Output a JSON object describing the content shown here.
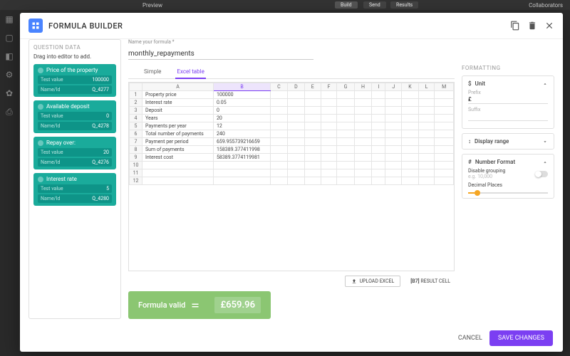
{
  "backdrop": {
    "preview": "Preview",
    "tabs": [
      "Build",
      "Send",
      "Results"
    ],
    "collaborators": "Collaborators"
  },
  "modal": {
    "title": "FORMULA BUILDER"
  },
  "question_data": {
    "title": "QUESTION DATA",
    "hint": "Drag into editor to add.",
    "cards": [
      {
        "title": "Price of the property",
        "test_label": "Test value",
        "test_value": "100000",
        "id_label": "Name/Id",
        "id_value": "Q_4277"
      },
      {
        "title": "Available deposit",
        "test_label": "Test value",
        "test_value": "0",
        "id_label": "Name/Id",
        "id_value": "Q_4278"
      },
      {
        "title": "Repay over:",
        "test_label": "Test value",
        "test_value": "20",
        "id_label": "Name/Id",
        "id_value": "Q_4276"
      },
      {
        "title": "Interest rate",
        "test_label": "Test value",
        "test_value": "5",
        "id_label": "Name/Id",
        "id_value": "Q_4280"
      }
    ]
  },
  "formula_name": {
    "label": "Name your formula *",
    "value": "monthly_repayments"
  },
  "tabs": {
    "simple": "Simple",
    "excel": "Excel table"
  },
  "chart_data": {
    "type": "table",
    "columns": [
      "A",
      "B",
      "C",
      "D",
      "E",
      "F",
      "G",
      "H",
      "I",
      "J",
      "K",
      "L",
      "M"
    ],
    "rows": [
      {
        "n": "1",
        "a": "Property price",
        "b": "100000"
      },
      {
        "n": "2",
        "a": "Interest rate",
        "b": "0.05"
      },
      {
        "n": "3",
        "a": "Deposit",
        "b": "0"
      },
      {
        "n": "4",
        "a": "Years",
        "b": "20"
      },
      {
        "n": "5",
        "a": "Payments per year",
        "b": "12"
      },
      {
        "n": "6",
        "a": "Total number of payments",
        "b": "240"
      },
      {
        "n": "7",
        "a": "Payment per period",
        "b": "659.955739216659"
      },
      {
        "n": "8",
        "a": "Sum of payments",
        "b": "158389.377411998"
      },
      {
        "n": "9",
        "a": "Interest cost",
        "b": "58389.3774119981"
      },
      {
        "n": "10",
        "a": "",
        "b": ""
      },
      {
        "n": "11",
        "a": "",
        "b": ""
      },
      {
        "n": "12",
        "a": "",
        "b": ""
      }
    ]
  },
  "actions": {
    "upload": "UPLOAD EXCEL",
    "result_cell_ref": "[B7]",
    "result_cell_label": "RESULT CELL"
  },
  "result": {
    "status": "Formula valid",
    "value": "£659.96"
  },
  "formatting": {
    "title": "FORMATTING",
    "unit": {
      "title": "Unit",
      "prefix_label": "Prefix",
      "prefix_value": "£",
      "suffix_label": "Suffix",
      "suffix_value": ""
    },
    "display_range": {
      "title": "Display range"
    },
    "number_format": {
      "title": "Number Format",
      "disable_grouping_label": "Disable grouping",
      "disable_grouping_hint": "e.g. 10,000",
      "decimal_places_label": "Decimal Places"
    }
  },
  "footer": {
    "cancel": "CANCEL",
    "save": "SAVE CHANGES"
  }
}
